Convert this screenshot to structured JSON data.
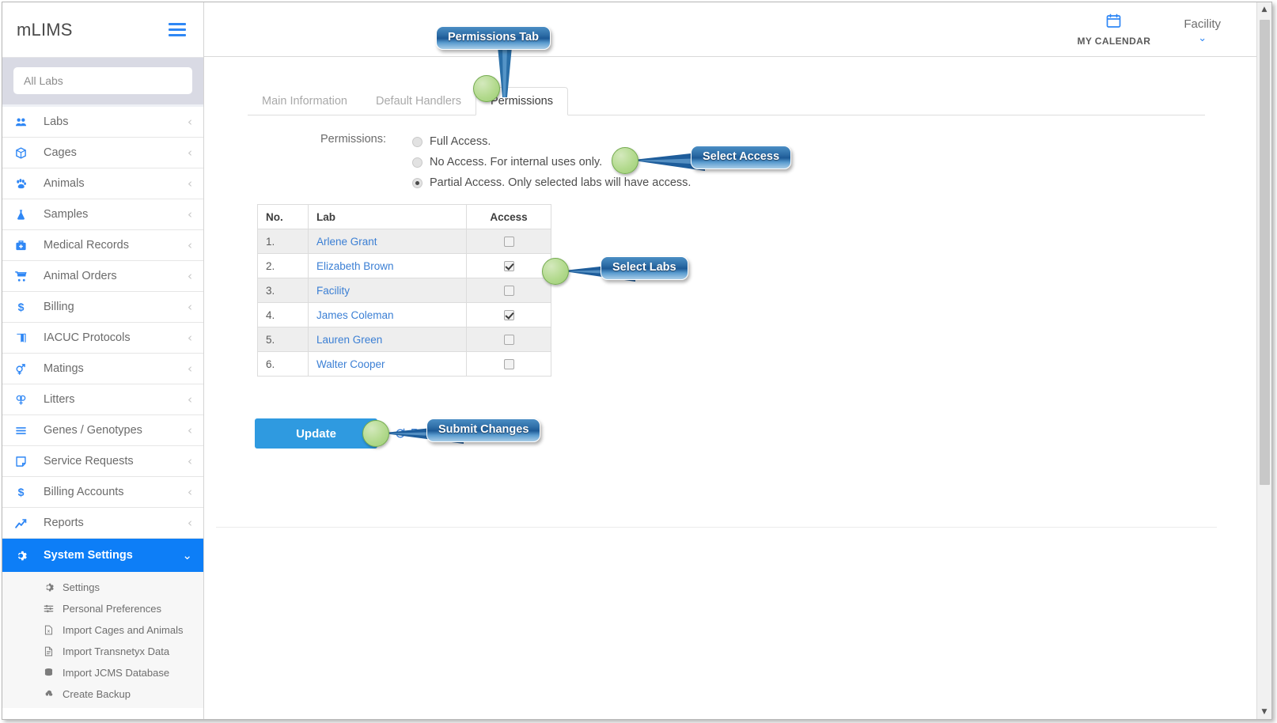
{
  "app": {
    "brand": "mLIMS",
    "menu_icon": "hamburger-icon"
  },
  "sidebar": {
    "search": {
      "placeholder": "All Labs",
      "value": ""
    },
    "items": [
      {
        "label": "Labs",
        "icon": "users-group-icon",
        "chevron": "‹"
      },
      {
        "label": "Cages",
        "icon": "box-icon",
        "chevron": "‹"
      },
      {
        "label": "Animals",
        "icon": "paw-icon",
        "chevron": "‹"
      },
      {
        "label": "Samples",
        "icon": "flask-icon",
        "chevron": "‹"
      },
      {
        "label": "Medical Records",
        "icon": "medical-kit-icon",
        "chevron": "‹"
      },
      {
        "label": "Animal Orders",
        "icon": "shopping-cart-icon",
        "chevron": "‹"
      },
      {
        "label": "Billing",
        "icon": "dollar-icon",
        "chevron": "‹"
      },
      {
        "label": "IACUC Protocols",
        "icon": "book-icon",
        "chevron": "‹"
      },
      {
        "label": "Matings",
        "icon": "gender-symbols-icon",
        "chevron": "‹"
      },
      {
        "label": "Litters",
        "icon": "female-symbols-icon",
        "chevron": "‹"
      },
      {
        "label": "Genes / Genotypes",
        "icon": "lines-icon",
        "chevron": "‹"
      },
      {
        "label": "Service Requests",
        "icon": "note-icon",
        "chevron": "‹"
      },
      {
        "label": "Billing Accounts",
        "icon": "dollar-icon",
        "chevron": "‹"
      },
      {
        "label": "Reports",
        "icon": "chart-line-icon",
        "chevron": "‹"
      }
    ],
    "active_item": {
      "label": "System Settings",
      "icon": "gear-icon",
      "chevron": "⌄"
    },
    "sub_items": [
      {
        "label": "Settings",
        "icon": "gear-icon"
      },
      {
        "label": "Personal Preferences",
        "icon": "sliders-icon"
      },
      {
        "label": "Import Cages and Animals",
        "icon": "excel-file-icon"
      },
      {
        "label": "Import Transnetyx Data",
        "icon": "document-icon"
      },
      {
        "label": "Import JCMS Database",
        "icon": "database-icon"
      },
      {
        "label": "Create Backup",
        "icon": "cloud-download-icon"
      }
    ]
  },
  "topbar": {
    "calendar": {
      "label": "MY CALENDAR",
      "icon": "calendar-icon"
    },
    "facility": {
      "label": "Facility",
      "chevron": "⌄",
      "icon": "chevron-down-icon"
    }
  },
  "tabs": [
    {
      "label": "Main Information",
      "active": false
    },
    {
      "label": "Default Handlers",
      "active": false
    },
    {
      "label": "Permissions",
      "active": true
    }
  ],
  "permissions": {
    "field_label": "Permissions:",
    "options": [
      {
        "label": "Full Access.",
        "selected": false
      },
      {
        "label": "No Access. For internal uses only.",
        "selected": false
      },
      {
        "label": "Partial Access. Only selected labs will have access.",
        "selected": true
      }
    ]
  },
  "table": {
    "headers": [
      "No.",
      "Lab",
      "Access"
    ],
    "rows": [
      {
        "no": "1.",
        "lab": "Arlene Grant",
        "access": false
      },
      {
        "no": "2.",
        "lab": "Elizabeth Brown",
        "access": true
      },
      {
        "no": "3.",
        "lab": "Facility",
        "access": false
      },
      {
        "no": "4.",
        "lab": "James Coleman",
        "access": true
      },
      {
        "no": "5.",
        "lab": "Lauren Green",
        "access": false
      },
      {
        "no": "6.",
        "lab": "Walter Cooper",
        "access": false
      }
    ]
  },
  "actions": {
    "update_label": "Update",
    "reset_label": "Reset",
    "reset_icon": "refresh-icon"
  },
  "callouts": [
    {
      "text": "Permissions Tab"
    },
    {
      "text": "Select Access"
    },
    {
      "text": "Select Labs"
    },
    {
      "text": "Submit Changes"
    }
  ],
  "scrollbar": {
    "up": "▲",
    "down": "▼"
  },
  "colors": {
    "accent_blue": "#0d7ef7",
    "link_blue": "#3b7fd4",
    "button_blue": "#2f9ae0",
    "callout_blue": "#1d5a96",
    "marker_green": "#9ccd74"
  }
}
